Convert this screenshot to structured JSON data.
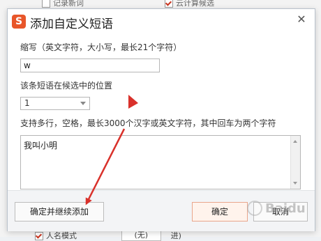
{
  "background": {
    "top_items": [
      {
        "label": "记录新词",
        "checked": false
      },
      {
        "label": "云计算候选",
        "checked": true
      }
    ],
    "bottom_row": {
      "label": "人名模式",
      "select_value": "(无)",
      "suffix": "进)"
    }
  },
  "dialog": {
    "logo_letter": "S",
    "title": "添加自定义短语",
    "close_glyph": "✕",
    "abbrev": {
      "label": "缩写（英文字符，大小写，最长21个字符）",
      "value": "w"
    },
    "position": {
      "label": "该条短语在候选中的位置",
      "value": "1"
    },
    "content": {
      "label": "支持多行，空格，最长3000个汉字或英文字符，其中回车为两个字符",
      "value": "我叫小明"
    },
    "buttons": {
      "confirm_continue": "确定并继续添加",
      "confirm": "确定",
      "cancel": "取消"
    }
  },
  "watermark": {
    "text": "Baidu"
  },
  "colors": {
    "brand": "#e8562a",
    "arrow": "#d9312b",
    "primary_button_border": "#e9a58b"
  }
}
